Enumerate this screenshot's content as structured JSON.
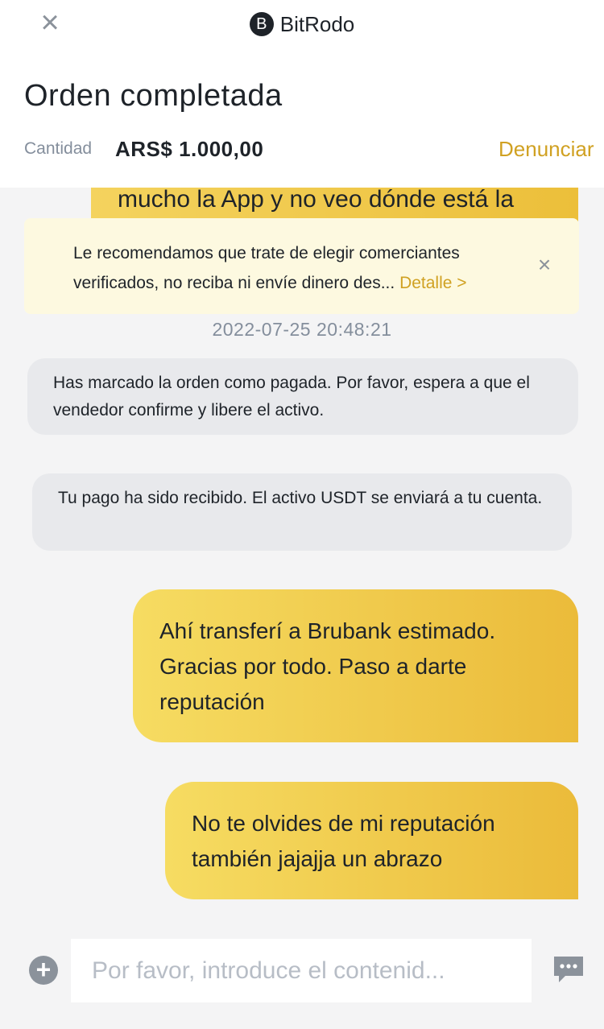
{
  "header": {
    "close_symbol": "×",
    "brand_initial": "B",
    "brand_name": "BitRodo",
    "title": "Orden completada",
    "quantity_label": "Cantidad",
    "quantity_value": "ARS$ 1.000,00",
    "report_label": "Denunciar"
  },
  "partial_message": "mucho la App y no veo dónde está la",
  "warning": {
    "text": "Le recomendamos que trate de elegir comerciantes verificados, no reciba ni envíe dinero des...",
    "link": "Detalle >",
    "close_symbol": "×"
  },
  "timestamp": "2022-07-25 20:48:21",
  "system_messages": [
    "Has marcado la orden como pagada. Por favor, espera a que el vendedor confirme y libere el activo.",
    "Tu pago ha sido recibido. El activo USDT se enviará a tu cuenta."
  ],
  "sent_messages": [
    "Ahí transferí a Brubank estimado. Gracias por todo. Paso a darte reputación",
    "No te olvides de mi reputación también jajajja un abrazo"
  ],
  "composer": {
    "plus_symbol": "+",
    "placeholder": "Por favor, introduce el contenid..."
  },
  "icons": [
    "close-icon",
    "brand-logo-icon",
    "warning-close-icon",
    "plus-icon",
    "chat-bubble-icon"
  ],
  "colors": {
    "accent": "#d0a122",
    "bubble_start": "#f6dc62",
    "bubble_end": "#ebbb3a",
    "warning_bg": "#fdf9e0"
  }
}
